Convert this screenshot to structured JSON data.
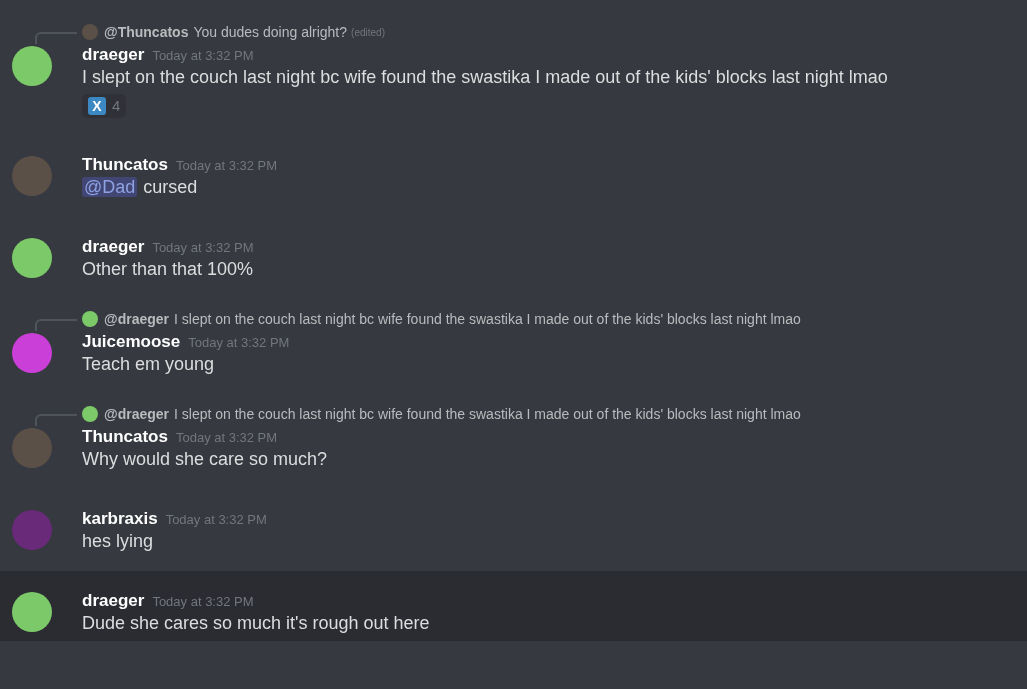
{
  "messages": [
    {
      "reply": {
        "author": "@Thuncatos",
        "text": "You dudes doing alright?",
        "edited": "(edited)",
        "color": "#5b5048"
      },
      "author": "draeger",
      "color": "#7cc96a",
      "time": "Today at 3:32 PM",
      "content": [
        {
          "kind": "text",
          "text": "I slept on the couch last night bc wife found the swastika I made out of the kids' blocks last night lmao"
        }
      ],
      "reaction": {
        "emoji": "X",
        "count": "4"
      },
      "hovered": false
    },
    {
      "author": "Thuncatos",
      "color": "#5b5048",
      "time": "Today at 3:32 PM",
      "content": [
        {
          "kind": "mention",
          "text": "@Dad"
        },
        {
          "kind": "text",
          "text": "cursed"
        }
      ],
      "hovered": false
    },
    {
      "author": "draeger",
      "color": "#7cc96a",
      "time": "Today at 3:32 PM",
      "content": [
        {
          "kind": "text",
          "text": "Other than that 100%"
        }
      ],
      "hovered": false
    },
    {
      "reply": {
        "author": "@draeger",
        "text": "I slept on the couch last night bc wife found the swastika I made out of the kids' blocks last night lmao",
        "color": "#7cc96a"
      },
      "author": "Juicemoose",
      "color": "#c93fd8",
      "time": "Today at 3:32 PM",
      "content": [
        {
          "kind": "text",
          "text": "Teach em young"
        }
      ],
      "hovered": false
    },
    {
      "reply": {
        "author": "@draeger",
        "text": "I slept on the couch last night bc wife found the swastika I made out of the kids' blocks last night lmao",
        "color": "#7cc96a"
      },
      "author": "Thuncatos",
      "color": "#5b5048",
      "time": "Today at 3:32 PM",
      "content": [
        {
          "kind": "text",
          "text": "Why would she care so much?"
        }
      ],
      "hovered": false
    },
    {
      "author": "karbraxis",
      "color": "#6a2a7a",
      "time": "Today at 3:32 PM",
      "content": [
        {
          "kind": "text",
          "text": "hes lying"
        }
      ],
      "hovered": false
    },
    {
      "author": "draeger",
      "color": "#7cc96a",
      "time": "Today at 3:32 PM",
      "content": [
        {
          "kind": "text",
          "text": "Dude she cares so much it's rough out here"
        }
      ],
      "hovered": true
    }
  ]
}
